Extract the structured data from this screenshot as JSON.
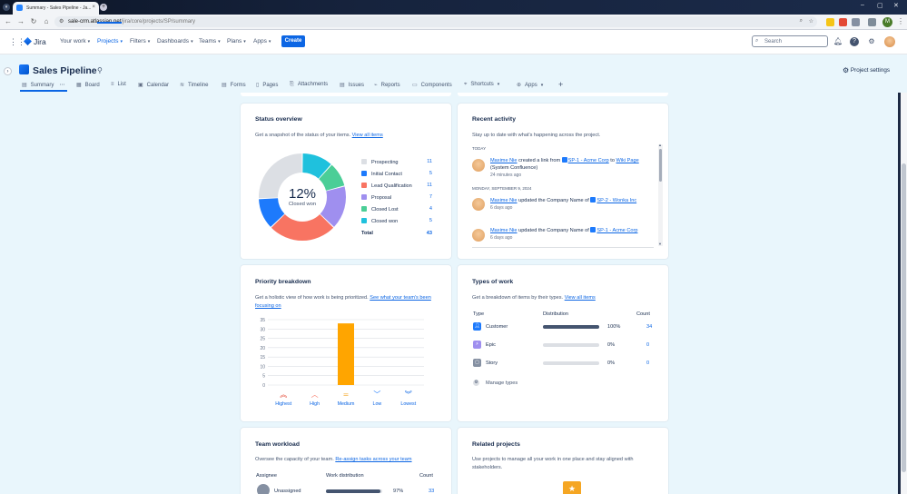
{
  "browser": {
    "tab_title": "Summary - Sales Pipeline - Ja...",
    "url_host": "sale-crm.atlassian.net",
    "url_path": "/jira/core/projects/SP/summary",
    "profile_initial": "M"
  },
  "nav": {
    "product": "Jira",
    "items": [
      "Your work",
      "Projects",
      "Filters",
      "Dashboards",
      "Teams",
      "Plans",
      "Apps"
    ],
    "active_index": 1,
    "create": "Create",
    "search_placeholder": "Search"
  },
  "project": {
    "title": "Sales Pipeline",
    "settings": "Project settings",
    "tabs": [
      "Summary",
      "Board",
      "List",
      "Calendar",
      "Timeline",
      "Forms",
      "Pages",
      "Attachments",
      "Issues",
      "Reports",
      "Components",
      "Shortcuts",
      "Apps"
    ],
    "add_tab": "+"
  },
  "status_overview": {
    "title": "Status overview",
    "subtitle": "Get a snapshot of the status of your items.",
    "link": "View all items",
    "center_value": "12%",
    "center_label": "Closed won",
    "items": [
      {
        "label": "Prospecting",
        "value": 11,
        "color": "#dcdfe4"
      },
      {
        "label": "Initial Contact",
        "value": 5,
        "color": "#1d7afc"
      },
      {
        "label": "Lead Qualification",
        "value": 11,
        "color": "#f87462"
      },
      {
        "label": "Proposal",
        "value": 7,
        "color": "#9f8fef"
      },
      {
        "label": "Closed Lost",
        "value": 4,
        "color": "#4bce97"
      },
      {
        "label": "Closed won",
        "value": 5,
        "color": "#1fc1dd"
      }
    ],
    "total_label": "Total",
    "total_value": 43
  },
  "recent_activity": {
    "title": "Recent activity",
    "subtitle": "Stay up to date with what's happening across the project.",
    "groups": [
      {
        "day": "TODAY",
        "entries": [
          {
            "user": "Maxime Nie",
            "action": " created a link from ",
            "item": "SP-1 - Acme Corp",
            "middle": " to ",
            "target": "Wiki Page",
            "suffix": " (System Confluence)",
            "time": "24 minutes ago"
          }
        ]
      },
      {
        "day": "MONDAY, SEPTEMBER 9, 2024",
        "entries": [
          {
            "user": "Maxime Nie",
            "action": " updated the Company Name of ",
            "item": "SP-2 - Wonka Inc",
            "time": "6 days ago"
          },
          {
            "user": "Maxime Nie",
            "action": " updated the Company Name of ",
            "item": "SP-1 - Acme Corp",
            "time": "6 days ago"
          }
        ]
      }
    ]
  },
  "priority": {
    "title": "Priority breakdown",
    "subtitle": "Get a holistic view of how work is being prioritized.",
    "link": "See what your team's been focusing on",
    "icon_colors": [
      "#e34935",
      "#f87462",
      "#f5a623",
      "#1d7afc",
      "#0c66e4"
    ]
  },
  "chart_data": {
    "type": "bar",
    "categories": [
      "Highest",
      "High",
      "Medium",
      "Low",
      "Lowest"
    ],
    "values": [
      0,
      0,
      33,
      0,
      0
    ],
    "ylim": [
      0,
      35
    ],
    "yticks": [
      0,
      5,
      10,
      15,
      20,
      25,
      30,
      35
    ],
    "bar_color": "#ffa500",
    "grid": true
  },
  "types_of_work": {
    "title": "Types of work",
    "subtitle": "Get a breakdown of items by their types.",
    "link": "View all items",
    "col_type": "Type",
    "col_dist": "Distribution",
    "col_count": "Count",
    "rows": [
      {
        "type": "Customer",
        "percent": "100%",
        "count": 34,
        "fraction": 1.0,
        "icon_color": "#1d7afc"
      },
      {
        "type": "Epic",
        "percent": "0%",
        "count": 0,
        "fraction": 0,
        "icon_color": "#9f8fef"
      },
      {
        "type": "Story",
        "percent": "0%",
        "count": 0,
        "fraction": 0,
        "icon_color": "#8590a2"
      }
    ],
    "manage": "Manage types"
  },
  "team_workload": {
    "title": "Team workload",
    "subtitle": "Oversee the capacity of your team.",
    "link": "Re-assign tasks across your team",
    "col_assignee": "Assignee",
    "col_dist": "Work distribution",
    "col_count": "Count",
    "rows": [
      {
        "name": "Unassigned",
        "percent": "97%",
        "count": 33,
        "fraction": 0.97
      }
    ]
  },
  "related_projects": {
    "title": "Related projects",
    "subtitle": "Use projects to manage all your work in one place and stay aligned with stakeholders."
  }
}
